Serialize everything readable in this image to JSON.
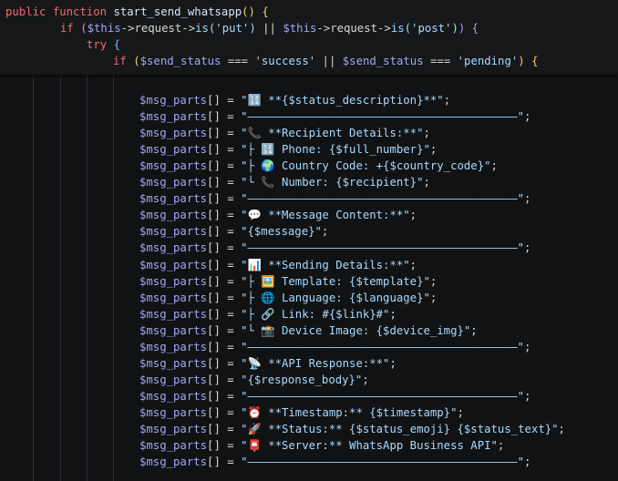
{
  "header": {
    "line1": {
      "kw_public": "public",
      "kw_function": "function",
      "fn_name": "start_send_whatsapp",
      "tail": "() {"
    },
    "line2": {
      "kw_if": "if",
      "p1": " (",
      "this1": "$this",
      "arrow1": "->request->",
      "is1": "is",
      "arg1": "('put')",
      "or": " || ",
      "this2": "$this",
      "arrow2": "->request->",
      "is2": "is",
      "arg2": "('post')",
      "tail": ") {"
    },
    "line3": {
      "kw_try": "try",
      "tail": " {"
    },
    "line4": {
      "kw_if": "if",
      "p1": " (",
      "v1": "$send_status",
      "eq1": " === ",
      "s1": "'success'",
      "or": " || ",
      "v2": "$send_status",
      "eq2": " === ",
      "s2": "'pending'",
      "tail": ") {"
    }
  },
  "code": {
    "var": "$msg_parts",
    "op": "[] = ",
    "lines": [
      {
        "str": "\"🔢 **{$status_description}**\"",
        "end": ";"
      },
      {
        "str": "\"————————————————————————————————————————\"",
        "end": ";"
      },
      {
        "str": "\"📞 **Recipient Details:**\"",
        "end": ";"
      },
      {
        "str": "\"├ 🔢 Phone: {$full_number}\"",
        "end": ";"
      },
      {
        "str": "\"├ 🌍 Country Code: +{$country_code}\"",
        "end": ";"
      },
      {
        "str": "\"└ 📞 Number: {$recipient}\"",
        "end": ";"
      },
      {
        "str": "\"————————————————————————————————————————\"",
        "end": ";"
      },
      {
        "str": "\"💬 **Message Content:**\"",
        "end": ";"
      },
      {
        "str": "\"{$message}\"",
        "end": ";"
      },
      {
        "str": "\"————————————————————————————————————————\"",
        "end": ";"
      },
      {
        "str": "\"📊 **Sending Details:**\"",
        "end": ";"
      },
      {
        "str": "\"├ 🖼️ Template: {$template}\"",
        "end": ";"
      },
      {
        "str": "\"├ 🌐 Language: {$language}\"",
        "end": ";"
      },
      {
        "str": "\"├ 🔗 Link: #{$link}#\"",
        "end": ";"
      },
      {
        "str": "\"└ 📸 Device Image: {$device_img}\"",
        "end": ";"
      },
      {
        "str": "\"————————————————————————————————————————\"",
        "end": ";"
      },
      {
        "str": "\"📡 **API Response:**\"",
        "end": ";"
      },
      {
        "str": "\"{$response_body}\"",
        "end": ";"
      },
      {
        "str": "\"————————————————————————————————————————\"",
        "end": ";"
      },
      {
        "str": "\"⏰ **Timestamp:** {$timestamp}\"",
        "end": ";"
      },
      {
        "str": "\"🚀 **Status:** {$status_emoji} {$status_text}\"",
        "end": ";"
      },
      {
        "str": "\"📮 **Server:** WhatsApp Business API\"",
        "end": ";"
      },
      {
        "str": "\"————————————————————————————————————————\"",
        "end": ";"
      }
    ]
  }
}
